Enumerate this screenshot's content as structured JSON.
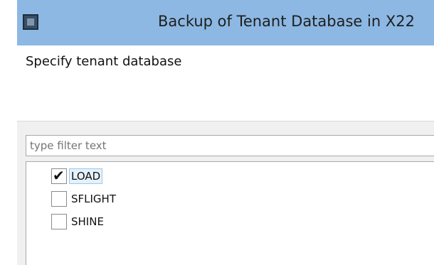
{
  "window": {
    "title": "Backup of Tenant Database in X22",
    "app_icon": "application-icon"
  },
  "header": {
    "heading": "Specify tenant database"
  },
  "filter": {
    "placeholder": "type filter text",
    "value": ""
  },
  "tenant_list": {
    "items": [
      {
        "label": "LOAD",
        "checked": true,
        "selected": true
      },
      {
        "label": "SFLIGHT",
        "checked": false,
        "selected": false
      },
      {
        "label": "SHINE",
        "checked": false,
        "selected": false
      }
    ]
  },
  "colors": {
    "titlebar": "#8cb8e3",
    "dialog_background": "#f0f0f0",
    "selection_background": "#e5f1fb",
    "selection_border": "#99c9ef"
  }
}
